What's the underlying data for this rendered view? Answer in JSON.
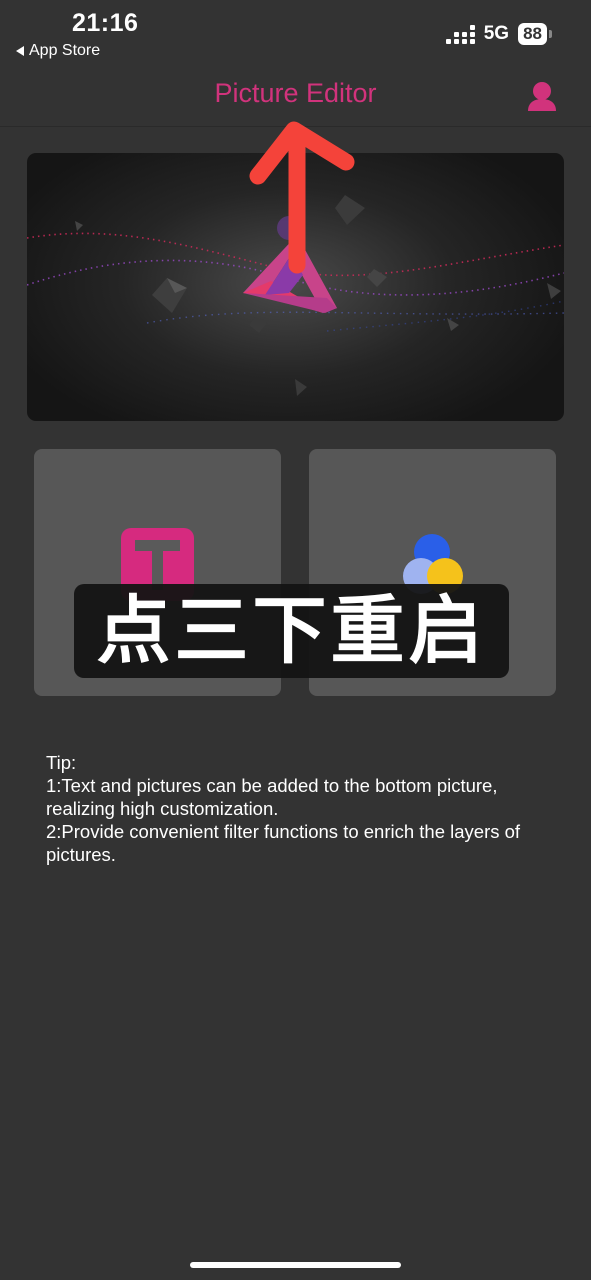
{
  "status_bar": {
    "time": "21:16",
    "back_app": "App Store",
    "network": "5G",
    "battery": "88"
  },
  "nav": {
    "title": "Picture Editor",
    "title_color": "#d1337c",
    "profile_icon": "person-icon"
  },
  "banner": {
    "icon": "penrose-triangle-logo"
  },
  "tools": [
    {
      "name": "text",
      "icon": "text-t-icon",
      "color": "#d62a7f"
    },
    {
      "name": "filter",
      "icon": "color-circles-icon"
    }
  ],
  "overlay": {
    "text": "点三下重启"
  },
  "tip": {
    "heading": "Tip:",
    "lines": [
      "1:Text and pictures can be added to the bottom picture, realizing high customization.",
      "2:Provide convenient filter functions to enrich the layers of pictures."
    ]
  },
  "annotation": {
    "type": "up-arrow",
    "color": "#f4433a"
  }
}
